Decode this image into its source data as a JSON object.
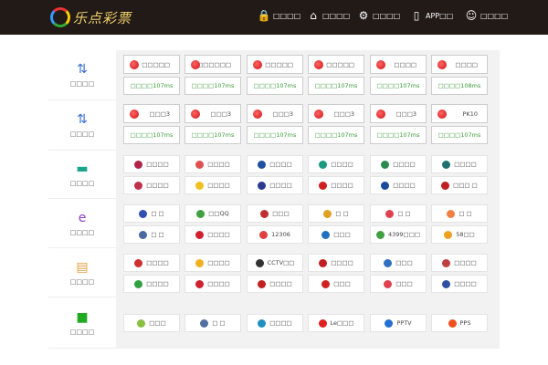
{
  "header": {
    "logo_text": "乐点彩票",
    "nav": [
      {
        "icon": "lock-icon",
        "glyph": "🔒",
        "label": "□□□□"
      },
      {
        "icon": "home-icon",
        "glyph": "⌂",
        "label": "□□□□"
      },
      {
        "icon": "gear-icon",
        "glyph": "⚙",
        "label": "□□□□"
      },
      {
        "icon": "phone-icon",
        "glyph": "▯",
        "label": "APP□□"
      },
      {
        "icon": "support-icon",
        "glyph": "☺",
        "label": "□□□□"
      }
    ]
  },
  "sections": [
    {
      "icon": "transfer-icon",
      "glyph": "⇅",
      "color": "#3a6fd8",
      "label": "□□□□"
    },
    {
      "icon": "transfer-icon",
      "glyph": "⇅",
      "color": "#3a6fd8",
      "label": "□□□□"
    },
    {
      "icon": "bank-card-icon",
      "glyph": "▬",
      "color": "#1aa58a",
      "label": "□□□□"
    },
    {
      "icon": "browser-icon",
      "glyph": "e",
      "color": "#8a3fc0",
      "label": "□□□□"
    },
    {
      "icon": "document-icon",
      "glyph": "▤",
      "color": "#e0a040",
      "label": "□□□□"
    },
    {
      "icon": "video-camera-icon",
      "glyph": "■",
      "color": "#22aa22",
      "label": "□□□□"
    }
  ],
  "lottery": {
    "row1": [
      "□□□□□",
      "□□□□□□",
      "□□□□□",
      "□□□□□",
      "□□□□",
      "□□□□"
    ],
    "row1_times": [
      "□□□□107ms",
      "□□□□107ms",
      "□□□□107ms",
      "□□□□107ms",
      "□□□□107ms",
      "□□□□108ms"
    ],
    "row2": [
      "□□□3",
      "□□□3",
      "□□□3",
      "□□□3",
      "□□□3",
      "PK10"
    ],
    "row2_times": [
      "□□□□107ms",
      "□□□□107ms",
      "□□□□107ms",
      "□□□□107ms",
      "□□□□107ms",
      "□□□□107ms"
    ]
  },
  "links": [
    [
      {
        "t": "□□□□",
        "c": "#b0224a"
      },
      {
        "t": "□□□□",
        "c": "#e05050"
      },
      {
        "t": "□□□□",
        "c": "#1f4fa0"
      },
      {
        "t": "□□□□",
        "c": "#1a9a80"
      },
      {
        "t": "□□□□",
        "c": "#2a8a50"
      },
      {
        "t": "□□□□",
        "c": "#207070"
      }
    ],
    [
      {
        "t": "□□□□",
        "c": "#c0304a"
      },
      {
        "t": "□□□□",
        "c": "#f0c020"
      },
      {
        "t": "□□□□",
        "c": "#2a3a90"
      },
      {
        "t": "□□□□",
        "c": "#d02020"
      },
      {
        "t": "□□□□",
        "c": "#1a4a9a"
      },
      {
        "t": "□□□ □",
        "c": "#c02020"
      }
    ],
    [
      {
        "t": "□ □",
        "c": "#3050b0"
      },
      {
        "t": "□□QQ",
        "c": "#40a040"
      },
      {
        "t": "□□□",
        "c": "#c03030"
      },
      {
        "t": "□ □",
        "c": "#e0a020"
      },
      {
        "t": "□ □",
        "c": "#e04050"
      },
      {
        "t": "□ □",
        "c": "#f08040"
      }
    ],
    [
      {
        "t": "□ □",
        "c": "#4a6aa0"
      },
      {
        "t": "□□□□",
        "c": "#d02030"
      },
      {
        "t": "12306",
        "c": "#e04040"
      },
      {
        "t": "□□□",
        "c": "#2070c0"
      },
      {
        "t": "4399□□□",
        "c": "#40a040"
      },
      {
        "t": "58□□",
        "c": "#f0a020"
      }
    ],
    [
      {
        "t": "□□□□",
        "c": "#d03030"
      },
      {
        "t": "□□□□",
        "c": "#f0b020"
      },
      {
        "t": "CCTV□□",
        "c": "#333333"
      },
      {
        "t": "□□□□",
        "c": "#c02020"
      },
      {
        "t": "□□□",
        "c": "#3070c0"
      },
      {
        "t": "□□□□",
        "c": "#c04040"
      }
    ],
    [
      {
        "t": "□□□□",
        "c": "#30a040"
      },
      {
        "t": "□□□□",
        "c": "#d02030"
      },
      {
        "t": "□□□□",
        "c": "#c02020"
      },
      {
        "t": "□□□",
        "c": "#d02020"
      },
      {
        "t": "□□□",
        "c": "#e04050"
      },
      {
        "t": "□□□□",
        "c": "#3050a0"
      }
    ],
    [
      {
        "t": "□□□",
        "c": "#8ac040"
      },
      {
        "t": "□ □",
        "c": "#5070a0"
      },
      {
        "t": "□□□□",
        "c": "#2090c0"
      },
      {
        "t": "Le□□□",
        "c": "#e02020"
      },
      {
        "t": "PPTV",
        "c": "#2070d0"
      },
      {
        "t": "PPS",
        "c": "#f05020"
      }
    ]
  ]
}
